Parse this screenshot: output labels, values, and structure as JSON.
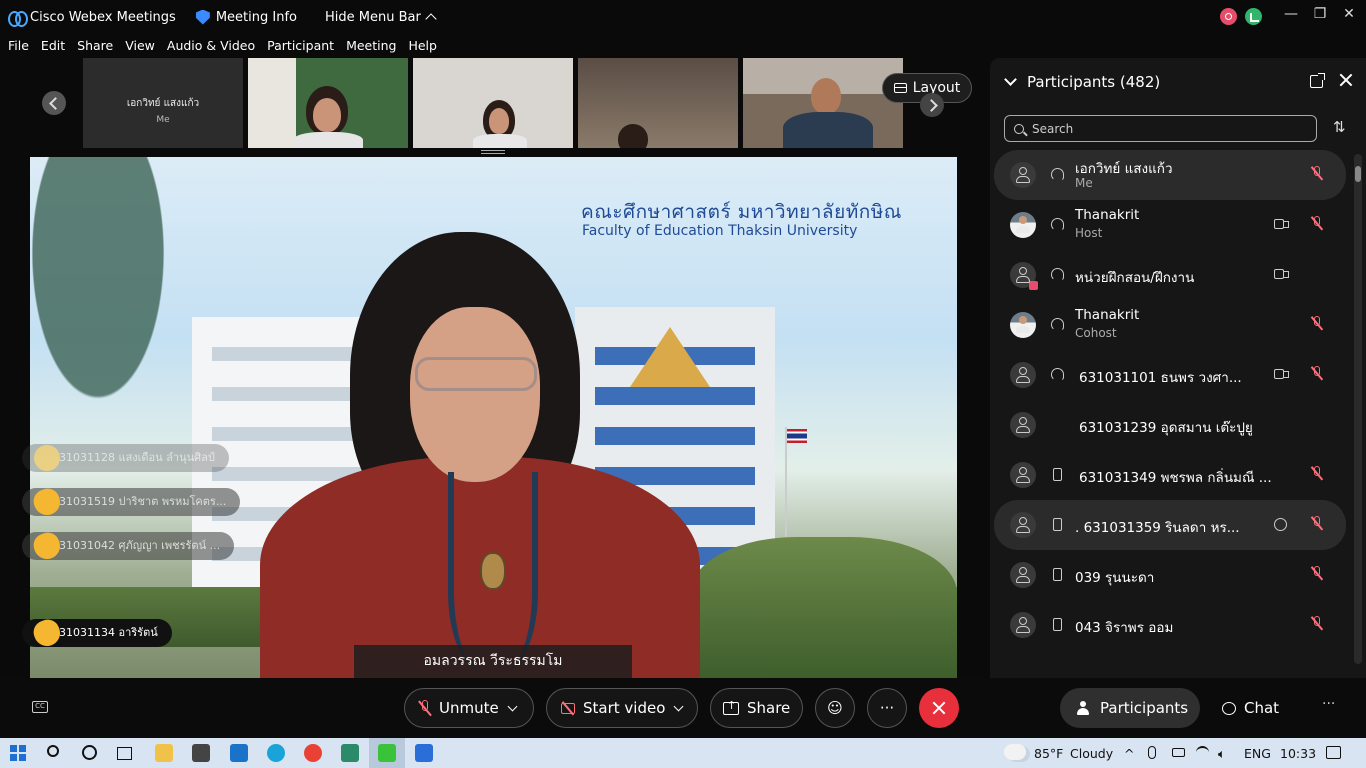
{
  "titlebar": {
    "app_title": "Cisco Webex Meetings",
    "meeting_info": "Meeting Info",
    "hide_menu": "Hide Menu Bar",
    "minimize": "—",
    "restore": "❐",
    "close": "✕"
  },
  "menu": [
    "File",
    "Edit",
    "Share",
    "View",
    "Audio & Video",
    "Participant",
    "Meeting",
    "Help"
  ],
  "thumbnails": {
    "me_name": "เอกวิทย์ แสงแก้ว",
    "me_sub": "Me"
  },
  "layout_button": "Layout",
  "main_video": {
    "banner_thai": "คณะศึกษาศาสตร์ มหาวิทยาลัยทักษิณ",
    "banner_english": "Faculty of Education Thaksin University",
    "speaker_name": "อมลวรรณ วีระธรรมโม"
  },
  "reactions": [
    "631031128 แสงเดือน ลำนุนศิลป์",
    "631031519 ปาริชาต พรหมโคตร...",
    "631031042 ศุภัญญา เพชรรัตน์ ...",
    "631031134 อาริรัตน์"
  ],
  "panel": {
    "title": "Participants (482)",
    "search_placeholder": "Search",
    "participants": [
      {
        "name": "เอกวิทย์ แสงแก้ว",
        "role": "Me"
      },
      {
        "name": "Thanakrit",
        "role": "Host"
      },
      {
        "name": "หน่วยฝึกสอน/ฝึกงาน",
        "role": ""
      },
      {
        "name": "Thanakrit",
        "role": "Cohost"
      },
      {
        "name": "631031101 ธนพร วงศา...",
        "role": ""
      },
      {
        "name": "631031239 อุดสมาน เต๊ะปูยู",
        "role": ""
      },
      {
        "name": "631031349 พชรพล กลิ่นมณี ...",
        "role": ""
      },
      {
        "name": ". 631031359 รินลดา หร...",
        "role": ""
      },
      {
        "name": "039 รุนนะดา",
        "role": ""
      },
      {
        "name": "043 จิราพร ออม",
        "role": ""
      }
    ]
  },
  "controls": {
    "unmute": "Unmute",
    "start_video": "Start video",
    "share": "Share",
    "more": "···",
    "participants": "Participants",
    "chat": "Chat",
    "more_right": "···",
    "cc": "CC"
  },
  "taskbar": {
    "temperature": "85°F",
    "weather": "Cloudy",
    "language": "ENG",
    "time": "10:33"
  }
}
